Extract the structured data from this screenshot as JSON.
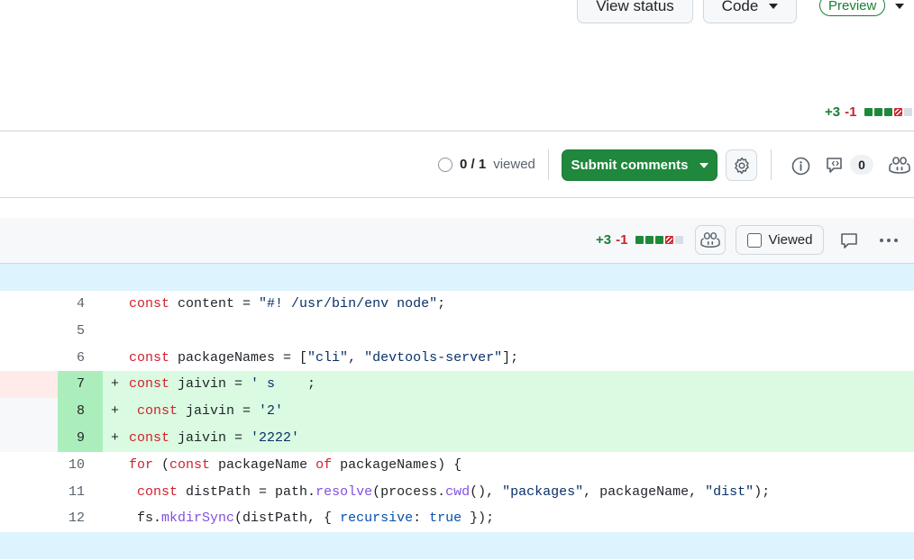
{
  "header": {
    "view_status_label": "View status",
    "code_label": "Code",
    "preview_label": "Preview"
  },
  "pr_diffstat": {
    "additions": "+3",
    "deletions": "-1",
    "blocks": [
      "added",
      "added",
      "added",
      "deleted",
      "neutral"
    ]
  },
  "toolbar": {
    "viewed_count": "0 / 1",
    "viewed_suffix": "viewed",
    "submit_label": "Submit comments",
    "comment_count": "0"
  },
  "file": {
    "additions": "+3",
    "deletions": "-1",
    "blocks": [
      "added",
      "added",
      "added",
      "deleted",
      "neutral"
    ],
    "viewed_label": "Viewed"
  },
  "diff_lines": [
    {
      "num": "4",
      "marker": "",
      "type": "context",
      "tokens": [
        [
          "kw",
          "const"
        ],
        [
          "",
          "  content = "
        ],
        [
          "str",
          "\"#! /usr/bin/env node\""
        ],
        [
          "",
          ";"
        ]
      ]
    },
    {
      "num": "5",
      "marker": "",
      "type": "context",
      "tokens": []
    },
    {
      "num": "6",
      "marker": "",
      "type": "context",
      "tokens": [
        [
          "kw",
          "const"
        ],
        [
          "",
          "  packageNames = ["
        ],
        [
          "str",
          "\"cli\""
        ],
        [
          "",
          ", "
        ],
        [
          "str",
          "\"devtools-server\""
        ],
        [
          "",
          "];"
        ]
      ]
    },
    {
      "num": "7",
      "marker": "+",
      "type": "added",
      "tokens": [
        [
          "kw",
          "const"
        ],
        [
          "",
          "  jaivin = "
        ],
        [
          "str",
          "' s     "
        ],
        [
          "",
          "  ;"
        ]
      ]
    },
    {
      "num": "8",
      "marker": "+",
      "type": "added",
      "tokens": [
        [
          "",
          "  "
        ],
        [
          "kw",
          "const"
        ],
        [
          "",
          "  jaivin = "
        ],
        [
          "str",
          "'2'"
        ]
      ]
    },
    {
      "num": "9",
      "marker": "+",
      "type": "added",
      "tokens": [
        [
          "kw",
          "const"
        ],
        [
          "",
          "  jaivin = "
        ],
        [
          "str",
          "'2222'"
        ]
      ]
    },
    {
      "num": "10",
      "marker": "",
      "type": "context",
      "tokens": [
        [
          "kw",
          "for"
        ],
        [
          "",
          "  ("
        ],
        [
          "kw",
          "const"
        ],
        [
          "",
          "  packageName "
        ],
        [
          "kw",
          "of"
        ],
        [
          "",
          "  packageNames) {"
        ]
      ]
    },
    {
      "num": "11",
      "marker": "",
      "type": "context",
      "tokens": [
        [
          "",
          "  "
        ],
        [
          "kw",
          "const"
        ],
        [
          "",
          "  distPath = path."
        ],
        [
          "fn",
          "resolve"
        ],
        [
          "",
          "(process."
        ],
        [
          "fn",
          "cwd"
        ],
        [
          "",
          "(), "
        ],
        [
          "str",
          "\"packages\""
        ],
        [
          "",
          ", packageName, "
        ],
        [
          "str",
          "\"dist\""
        ],
        [
          "",
          ");"
        ]
      ]
    },
    {
      "num": "12",
      "marker": "",
      "type": "context",
      "tokens": [
        [
          "",
          "  fs."
        ],
        [
          "fn",
          "mkdirSync"
        ],
        [
          "",
          "(distPath, { "
        ],
        [
          "cst",
          "recursive"
        ],
        [
          "",
          ": "
        ],
        [
          "cst",
          "true"
        ],
        [
          "",
          "  });"
        ]
      ]
    }
  ],
  "colors": {
    "added_bg": "#dafbe1",
    "added_num_bg": "#aceebb",
    "hunk_bg": "#ddf4ff",
    "primary_green": "#1f883d",
    "deleted_red": "#cf222e"
  }
}
